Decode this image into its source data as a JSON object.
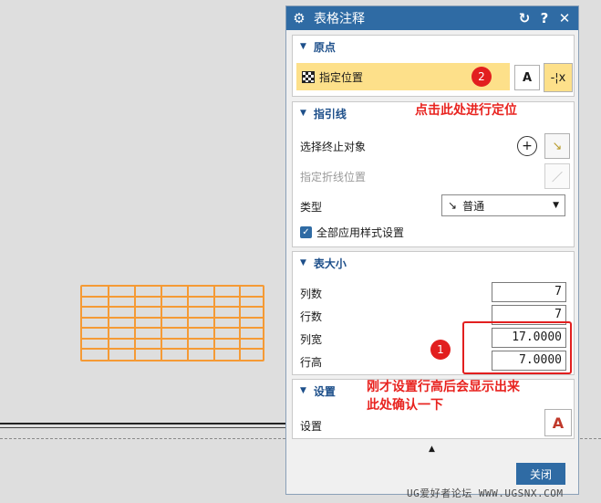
{
  "dialog": {
    "title": "表格注释",
    "reset_icon": "reset-icon",
    "help_label": "?",
    "close_label": "✕"
  },
  "origin": {
    "header": "原点",
    "specify_location": "指定位置",
    "badge": "2"
  },
  "leader": {
    "header": "指引线",
    "select_terminal": "选择终止对象",
    "specify_jog": "指定折线位置",
    "type_label": "类型",
    "type_value": "普通",
    "apply_all_styles": "全部应用样式设置"
  },
  "table_size": {
    "header": "表大小",
    "columns_label": "列数",
    "columns_value": "7",
    "rows_label": "行数",
    "rows_value": "7",
    "col_width_label": "列宽",
    "col_width_value": "17.0000",
    "row_height_label": "行高",
    "row_height_value": "7.0000",
    "badge": "1"
  },
  "settings": {
    "header": "设置",
    "settings_label": "设置"
  },
  "footer": {
    "close_button": "关闭"
  },
  "annotations": {
    "click_here": "点击此处进行定位",
    "confirm_line1": "刚才设置行高后会显示出来",
    "confirm_line2": "此处确认一下"
  },
  "watermark": "UG爱好者论坛 WWW.UGSNX.COM",
  "colors": {
    "titlebar": "#2f6ba4",
    "table_preview": "#f59a35",
    "highlight": "#fde08a",
    "annotation_red": "#e8231f"
  }
}
